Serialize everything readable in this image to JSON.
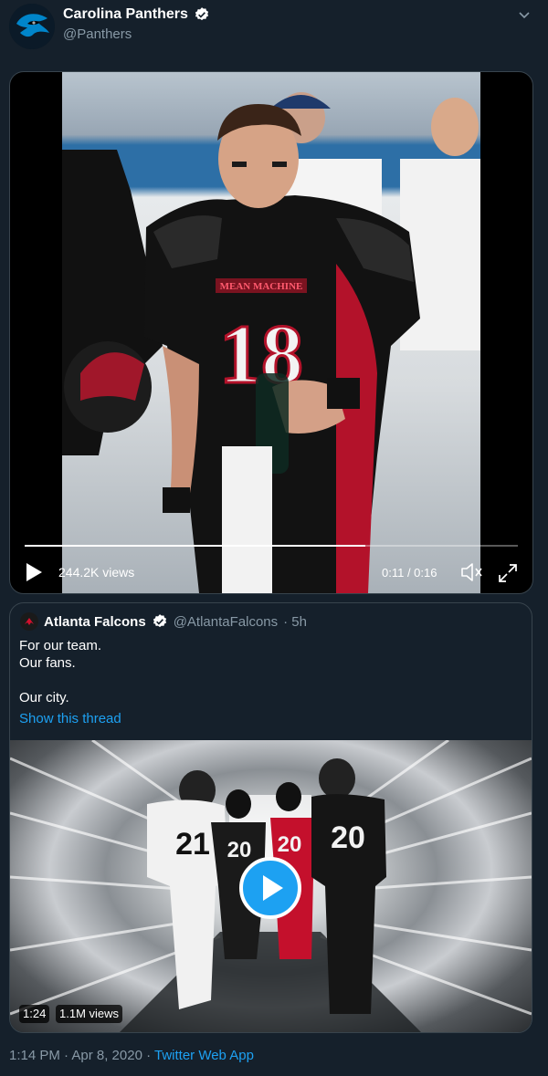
{
  "tweet": {
    "display_name": "Carolina Panthers",
    "handle": "@Panthers",
    "timestamp": "1:14 PM · Apr 8, 2020",
    "source_separator": " · ",
    "source": "Twitter Web App"
  },
  "video": {
    "jersey_number": "18",
    "jersey_text": "MEAN MACHINE",
    "views": "244.2K views",
    "time": "0:11 / 0:16",
    "progress": 0.69
  },
  "quote": {
    "display_name": "Atlanta Falcons",
    "handle": "@AtlantaFalcons",
    "age": "· 5h",
    "text_line1": "For our team.",
    "text_line2": "Our fans.",
    "text_line3": "Our city.",
    "show_thread": "Show this thread",
    "media": {
      "duration": "1:24",
      "views": "1.1M views",
      "jersey_numbers": [
        "21",
        "20",
        "20",
        "20"
      ]
    }
  },
  "colors": {
    "background": "#15202b",
    "accent": "#1da1f2",
    "muted": "#8899a6",
    "border": "#38444d"
  },
  "icons": [
    "verified-icon",
    "chevron-down-icon",
    "play-icon",
    "volume-icon",
    "fullscreen-icon"
  ]
}
